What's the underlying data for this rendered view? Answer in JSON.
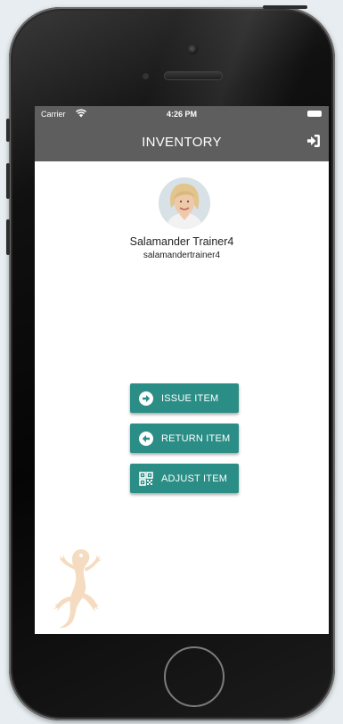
{
  "status_bar": {
    "carrier": "Carrier",
    "time": "4:26 PM"
  },
  "nav": {
    "title": "INVENTORY",
    "logout_icon": "logout-icon"
  },
  "profile": {
    "display_name": "Salamander Trainer4",
    "username": "salamandertrainer4"
  },
  "actions": [
    {
      "label": "ISSUE ITEM",
      "icon": "arrow-right-circle-icon"
    },
    {
      "label": "RETURN ITEM",
      "icon": "arrow-left-circle-icon"
    },
    {
      "label": "ADJUST ITEM",
      "icon": "qr-code-icon"
    }
  ],
  "colors": {
    "header": "#5e5e5e",
    "button": "#2a8e86",
    "logo": "#f5dcc0"
  }
}
